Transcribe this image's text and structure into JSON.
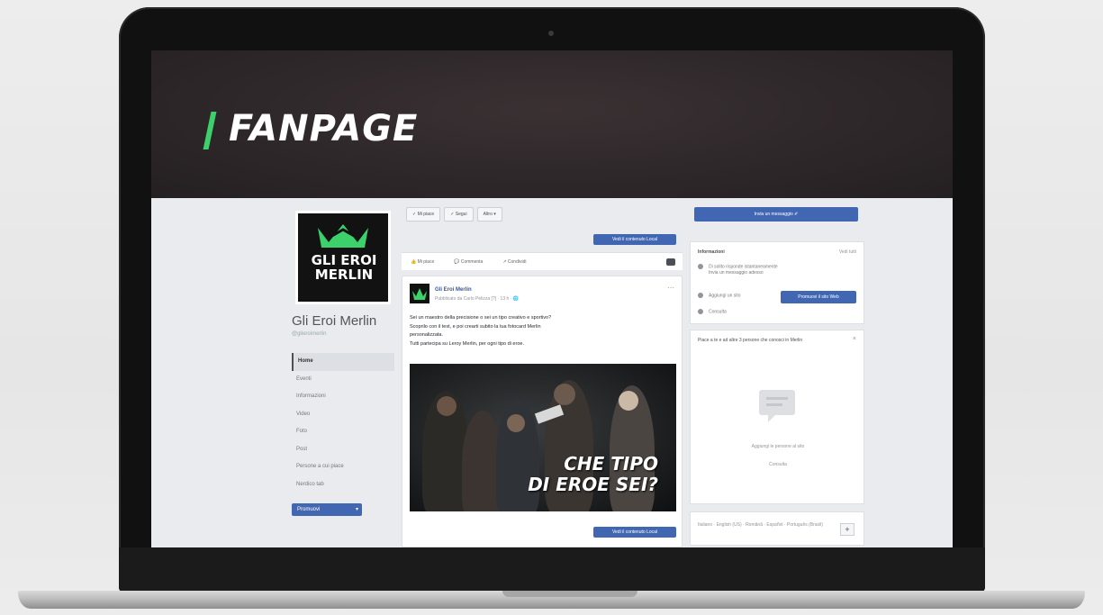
{
  "banner": {
    "title": "FANPAGE"
  },
  "page": {
    "logo_line1": "GLI EROI",
    "logo_line2": "MERLIN",
    "name": "Gli Eroi Merlin",
    "handle": "@glieroimerlin"
  },
  "nav": {
    "items": [
      "Home",
      "Eventi",
      "Informazioni",
      "Video",
      "Foto",
      "Post",
      "Persone a cui piace",
      "Nerdico tab"
    ],
    "promote_label": "Promuovi"
  },
  "actions": {
    "top": [
      "✓ Mi piace",
      "✓ Segui",
      "Altro ▾"
    ],
    "sponsor_label": "Vedi il contenuto Local",
    "reactions": [
      "👍 Mi piace",
      "💬 Commenta",
      "↗ Condividi"
    ]
  },
  "post": {
    "author": "Gli Eroi Merlin",
    "meta": "Pubblicato da Carlo Pelizza [?] · 13 h · 🌐",
    "more": "⋯",
    "text_lines": [
      "Sei un maestro della precisione o sei un tipo creativo e sportivo?",
      "Scoprilo con il test, e poi crearti subito la tua fotocard Merlin",
      "personalizzata.",
      "Tutti partecipa su Leroy Merlin, per ogni tipo di eroe."
    ],
    "image_caption_line1": "CHE TIPO",
    "image_caption_line2": "DI EROE SEI?"
  },
  "sidebar": {
    "send_message": "Invia un messaggio ✐",
    "info_title": "Informazioni",
    "info_edit": "Vedi tutti",
    "info_row1_line1": "Di solito risponde istantaneamente",
    "info_row1_line2": "Invia un messaggio adesso",
    "info_row2": "Aggiungi un sito",
    "info_row3": "Consulta",
    "promote_page": "Promuovi il sito Web",
    "people_title": "Piace a te e ad altre 3 persone che conosci in Merlin",
    "people_close": "×",
    "people_text": "Aggiungi le persone al sito",
    "people_link": "Consulta",
    "languages": "Italiano · English (US) · Română · Español · Português (Brasil)",
    "lang_add": "+"
  },
  "colors": {
    "accent": "#4267b2",
    "banner_green": "#3dd16b"
  }
}
